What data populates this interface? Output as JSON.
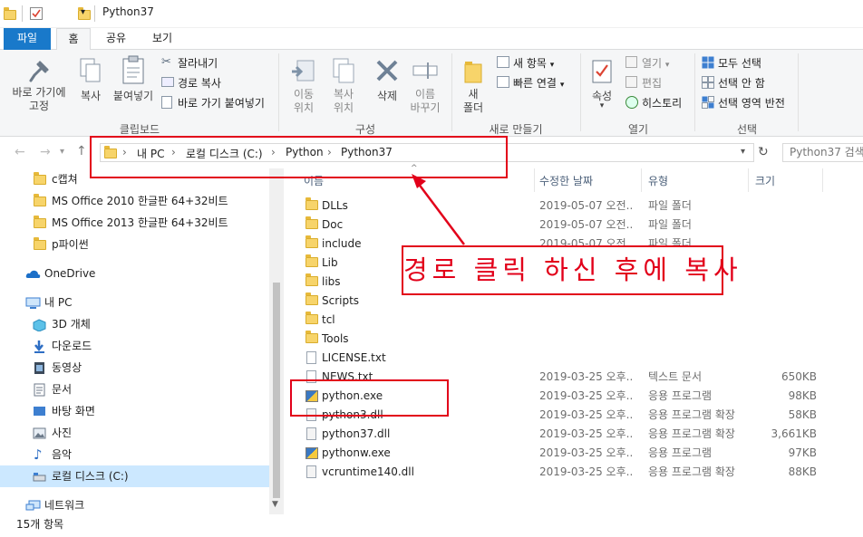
{
  "window": {
    "title": "Python37"
  },
  "tabs": [
    "파일",
    "홈",
    "공유",
    "보기"
  ],
  "ribbon": {
    "clipboard": {
      "pin_label": "바로 가기에\n고정",
      "copy_label": "복사",
      "paste_label": "붙여넣기",
      "cut_label": "잘라내기",
      "copy_path_label": "경로 복사",
      "paste_shortcut_label": "바로 가기 붙여넣기",
      "group_label": "클립보드"
    },
    "organize": {
      "move_label": "이동\n위치",
      "copy_to_label": "복사\n위치",
      "delete_label": "삭제",
      "rename_label": "이름\n바꾸기",
      "group_label": "구성"
    },
    "new": {
      "new_folder_label": "새\n폴더",
      "new_item_label": "새 항목",
      "easy_access_label": "빠른 연결",
      "group_label": "새로 만들기"
    },
    "open": {
      "properties_label": "속성",
      "open_label": "열기",
      "edit_label": "편집",
      "history_label": "히스토리",
      "group_label": "열기"
    },
    "select": {
      "select_all_label": "모두 선택",
      "select_none_label": "선택 안 함",
      "invert_label": "선택 영역 반전",
      "group_label": "선택"
    }
  },
  "address": {
    "crumbs": [
      "내 PC",
      "로컬 디스크 (C:)",
      "Python",
      "Python37"
    ],
    "search_placeholder": "Python37 검색"
  },
  "nav": {
    "items": [
      {
        "label": "c캡쳐",
        "icon": "folder-icon"
      },
      {
        "label": "MS Office 2010 한글판 64+32비트",
        "icon": "folder-icon"
      },
      {
        "label": "MS Office 2013 한글판 64+32비트",
        "icon": "folder-icon"
      },
      {
        "label": "p파이썬",
        "icon": "folder-icon"
      },
      {
        "label": "OneDrive",
        "icon": "cloud-icon"
      },
      {
        "label": "내 PC",
        "icon": "computer-icon"
      },
      {
        "label": "3D 개체",
        "icon": "cube-icon"
      },
      {
        "label": "다운로드",
        "icon": "download-icon"
      },
      {
        "label": "동영상",
        "icon": "video-icon"
      },
      {
        "label": "문서",
        "icon": "document-icon"
      },
      {
        "label": "바탕 화면",
        "icon": "desktop-icon"
      },
      {
        "label": "사진",
        "icon": "picture-icon"
      },
      {
        "label": "음악",
        "icon": "music-icon"
      },
      {
        "label": "로컬 디스크 (C:)",
        "icon": "drive-icon"
      },
      {
        "label": "네트워크",
        "icon": "network-icon"
      }
    ]
  },
  "columns": {
    "name": "이름",
    "date": "수정한 날짜",
    "type": "유형",
    "size": "크기"
  },
  "files": [
    {
      "name": "DLLs",
      "date": "2019-05-07 오전...",
      "type": "파일 폴더",
      "size": "",
      "icon": "folder-icon"
    },
    {
      "name": "Doc",
      "date": "2019-05-07 오전...",
      "type": "파일 폴더",
      "size": "",
      "icon": "folder-icon"
    },
    {
      "name": "include",
      "date": "2019-05-07 오전...",
      "type": "파일 폴더",
      "size": "",
      "icon": "folder-icon"
    },
    {
      "name": "Lib",
      "date": "",
      "type": "",
      "size": "",
      "icon": "folder-icon"
    },
    {
      "name": "libs",
      "date": "",
      "type": "",
      "size": "",
      "icon": "folder-icon"
    },
    {
      "name": "Scripts",
      "date": "",
      "type": "",
      "size": "",
      "icon": "folder-icon"
    },
    {
      "name": "tcl",
      "date": "",
      "type": "",
      "size": "",
      "icon": "folder-icon"
    },
    {
      "name": "Tools",
      "date": "",
      "type": "",
      "size": "",
      "icon": "folder-icon"
    },
    {
      "name": "LICENSE.txt",
      "date": "",
      "type": "",
      "size": "",
      "icon": "text-file-icon"
    },
    {
      "name": "NEWS.txt",
      "date": "2019-03-25 오후...",
      "type": "텍스트 문서",
      "size": "650KB",
      "icon": "text-file-icon"
    },
    {
      "name": "python.exe",
      "date": "2019-03-25 오후...",
      "type": "응용 프로그램",
      "size": "98KB",
      "icon": "python-exe-icon"
    },
    {
      "name": "python3.dll",
      "date": "2019-03-25 오후...",
      "type": "응용 프로그램 확장",
      "size": "58KB",
      "icon": "dll-icon"
    },
    {
      "name": "python37.dll",
      "date": "2019-03-25 오후...",
      "type": "응용 프로그램 확장",
      "size": "3,661KB",
      "icon": "dll-icon"
    },
    {
      "name": "pythonw.exe",
      "date": "2019-03-25 오후...",
      "type": "응용 프로그램",
      "size": "97KB",
      "icon": "python-exe-icon"
    },
    {
      "name": "vcruntime140.dll",
      "date": "2019-03-25 오후...",
      "type": "응용 프로그램 확장",
      "size": "88KB",
      "icon": "dll-icon"
    }
  ],
  "status": {
    "item_count": "15개 항목"
  },
  "annotation": {
    "text": "경로 클릭 하신 후에 복사",
    "color": "#e2001a"
  },
  "colors": {
    "file_tab": "#1979ca",
    "selected_nav": "#cce8ff"
  }
}
